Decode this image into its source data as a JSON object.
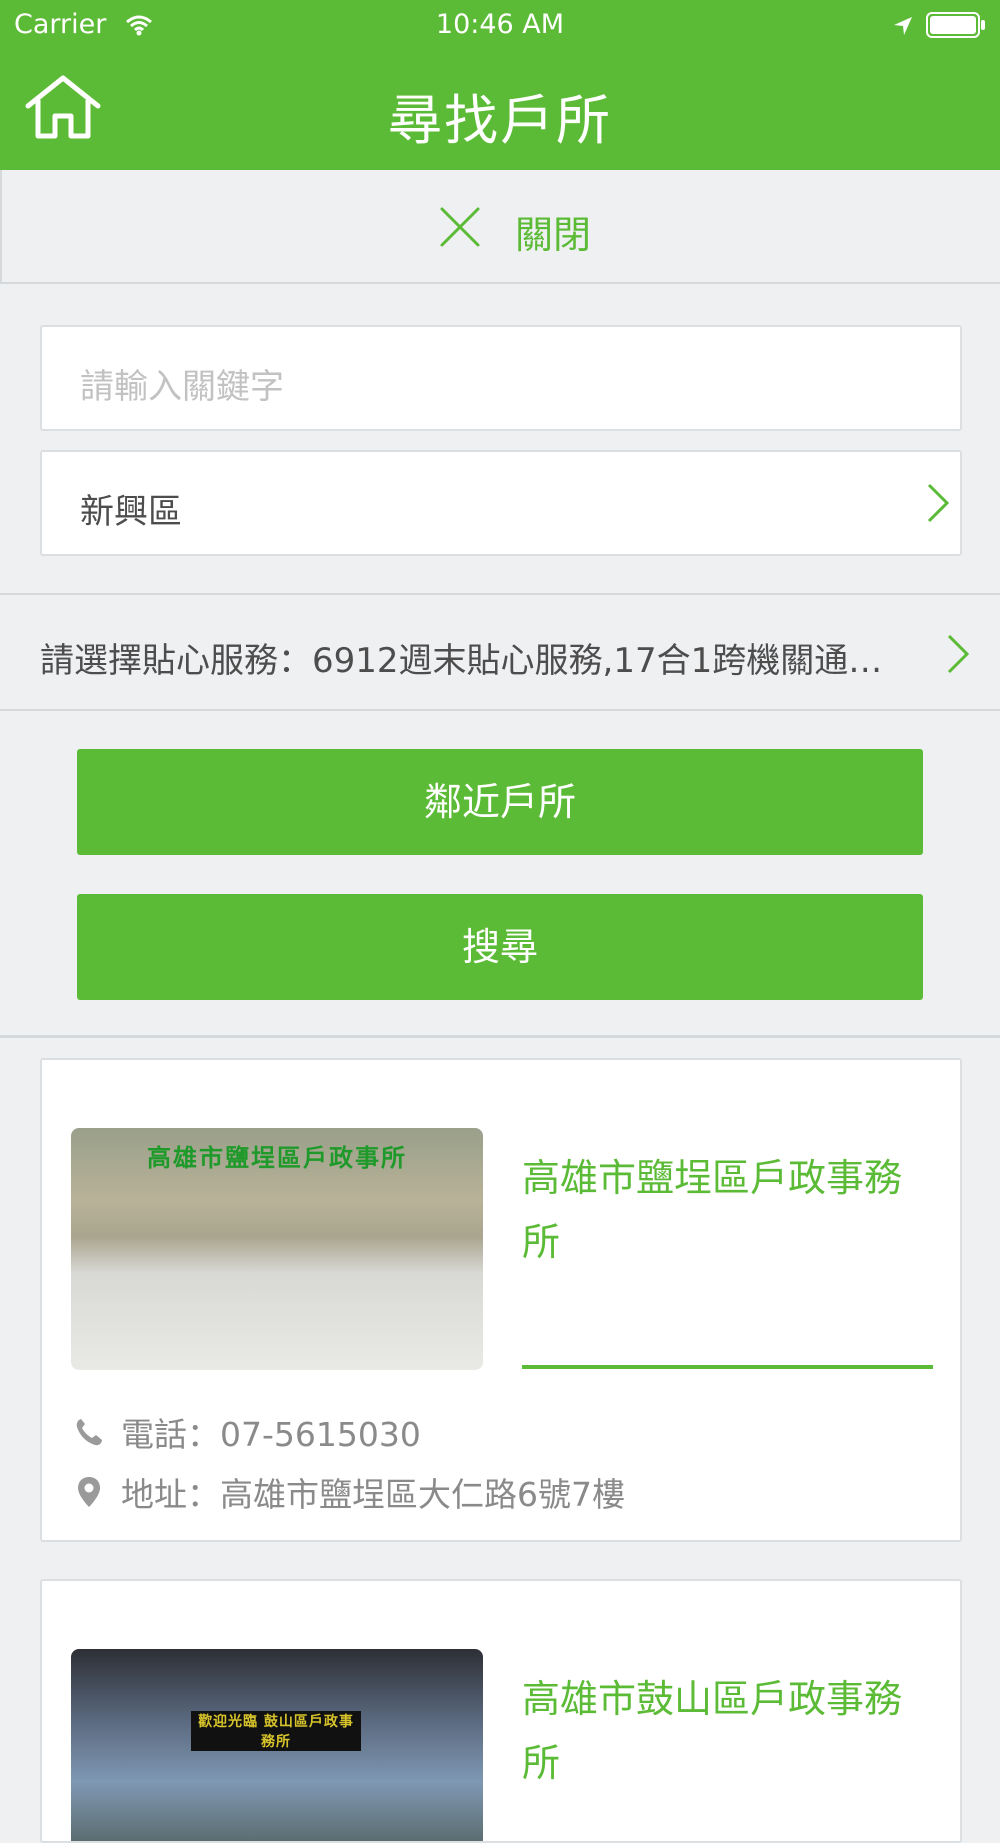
{
  "status_bar": {
    "carrier": "Carrier",
    "time": "10:46 AM"
  },
  "nav": {
    "title": "尋找戶所"
  },
  "close_bar": {
    "label": "關閉"
  },
  "search": {
    "keyword_placeholder": "請輸入關鍵字",
    "district_value": "新興區"
  },
  "service": {
    "text": "請選擇貼心服務：6912週末貼心服務,17合1跨機關通…"
  },
  "buttons": {
    "nearby": "鄰近戶所",
    "search": "搜尋"
  },
  "offices": [
    {
      "name": "高雄市鹽埕區戶政事務所",
      "sign": "高雄市鹽埕區戶政事所",
      "phone": "電話：07-5615030",
      "address": "地址：高雄市鹽埕區大仁路6號7樓"
    },
    {
      "name": "高雄市鼓山區戶政事務所",
      "sign": "歡迎光臨 鼓山區戶政事務所"
    }
  ],
  "colors": {
    "brand_green": "#5cbb36",
    "background": "#eef0f2"
  },
  "icons": [
    "wifi-icon",
    "location-arrow-icon",
    "battery-icon",
    "home-icon",
    "close-icon",
    "chevron-right-icon",
    "phone-icon",
    "map-pin-icon"
  ]
}
